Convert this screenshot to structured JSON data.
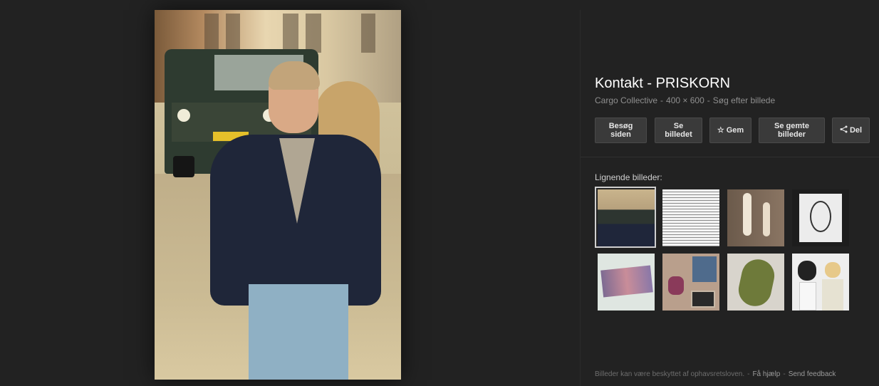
{
  "image": {
    "alt": "Man in navy jacket walking on street"
  },
  "details": {
    "title": "Kontakt - PRISKORN",
    "source": "Cargo Collective",
    "dimensions": "400 × 600",
    "search_by_image": "Søg efter billede",
    "separator": "-"
  },
  "actions": {
    "visit": "Besøg siden",
    "view": "Se billedet",
    "save": "Gem",
    "saved": "Se gemte billeder",
    "share": "Del"
  },
  "similar": {
    "label": "Lignende billeder:"
  },
  "footer": {
    "notice": "Billeder kan være beskyttet af ophavsretsloven.",
    "help": "Få hjælp",
    "feedback": "Send feedback",
    "separator": "-"
  },
  "colors": {
    "background": "#222222",
    "button": "#3a3a3a",
    "title": "#ffffff",
    "meta": "#8f8f8f"
  },
  "icons": {
    "save": "star-icon",
    "share": "share-icon"
  }
}
